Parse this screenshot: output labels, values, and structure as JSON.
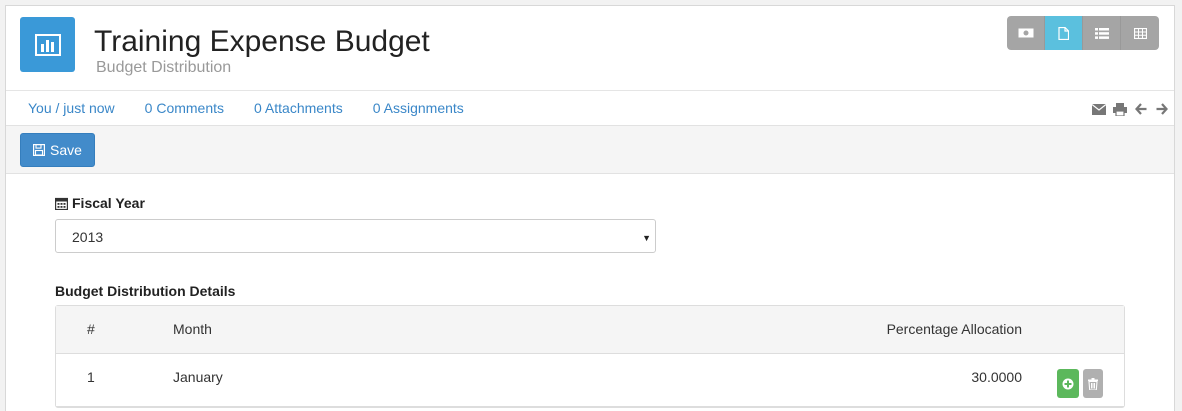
{
  "header": {
    "title": "Training Expense Budget",
    "subtitle": "Budget Distribution",
    "app_icon": "bar-chart-icon",
    "view_switch": [
      {
        "icon": "money-icon",
        "active": false
      },
      {
        "icon": "document-icon",
        "active": true
      },
      {
        "icon": "list-icon",
        "active": false
      },
      {
        "icon": "table-icon",
        "active": false
      }
    ]
  },
  "meta": {
    "owner": "You / just now",
    "comments": "0 Comments",
    "attachments": "0 Attachments",
    "assignments": "0 Assignments",
    "icons": [
      "envelope-icon",
      "print-icon",
      "arrow-left-icon",
      "arrow-right-icon"
    ]
  },
  "toolbar": {
    "save_label": "Save",
    "save_icon": "floppy-disk-icon"
  },
  "form": {
    "fiscal_year_label": "Fiscal Year",
    "fiscal_year_icon": "calendar-icon",
    "fiscal_year_value": "2013",
    "details_label": "Budget Distribution Details",
    "table": {
      "headers": {
        "num": "#",
        "month": "Month",
        "percentage": "Percentage Allocation"
      },
      "rows": [
        {
          "num": "1",
          "month": "January",
          "percentage": "30.0000"
        }
      ]
    }
  },
  "colors": {
    "accent": "#3a99d8",
    "link": "#3a87c8",
    "primary_button": "#428bca",
    "active_view": "#5bc0de",
    "add_button": "#5cb85c"
  }
}
